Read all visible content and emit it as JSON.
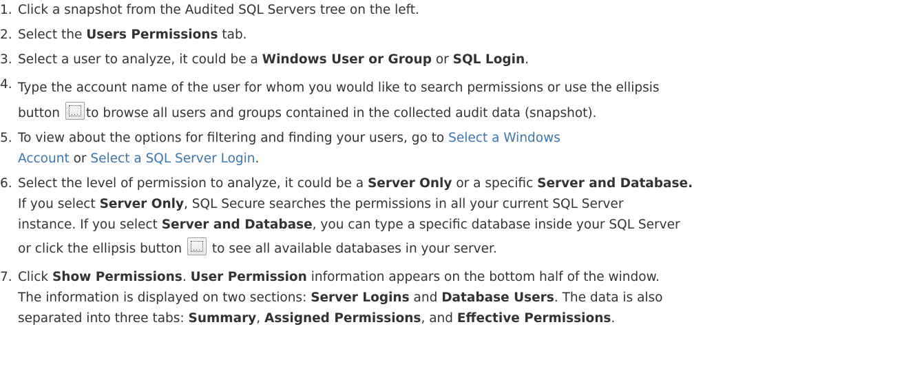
{
  "steps": [
    {
      "num": "1.",
      "t1": "Click a snapshot from the Audited SQL Servers tree on the left."
    },
    {
      "num": "2.",
      "t1": "Select the ",
      "b1": "Users Permissions",
      "t2": " tab."
    },
    {
      "num": "3.",
      "t1": "Select a user to analyze, it could be a ",
      "b1": "Windows User or Group",
      "t2": " or ",
      "b2": "SQL Login",
      "t3": "."
    },
    {
      "num": "4.",
      "line1": "Type the account name of the user for whom you would like to search permissions or use the ellipsis",
      "line2_pre": "button ",
      "line2_post": "to browse all users and groups contained in the collected audit data (snapshot)."
    },
    {
      "num": "5.",
      "t1": "To view about the options for filtering and finding your users, go to ",
      "link1_a": "Select a Windows",
      "link1_b": "Account",
      "t2": " or ",
      "link2": "Select a SQL Server Login",
      "t3": "."
    },
    {
      "num": "6.",
      "t1": "Select the level of permission to analyze, it could be a ",
      "b1": "Server Only",
      "t2": " or a specific ",
      "b2": "Server and Database.",
      "t3": "If you select ",
      "b3": "Server Only",
      "t4": ", SQL Secure searches the permissions in all your current SQL Server",
      "t5": "instance. If you select ",
      "b4": "Server and Database",
      "t6": ", you can type a specific database inside your SQL Server",
      "t7": "or click the ellipsis button ",
      "t8": " to see all available databases in your server."
    },
    {
      "num": "7.",
      "t1": "Click ",
      "b1": "Show Permissions",
      "t2": ". ",
      "b2": "User Permission",
      "t3": " information appears on the bottom half of the window.",
      "t4": "The information is displayed on two sections: ",
      "b3": "Server Logins",
      "t5": " and ",
      "b4": "Database Users",
      "t6": ". The data is also",
      "t7": "separated into three tabs: ",
      "b5": "Summary",
      "t8": ", ",
      "b6": "Assigned Permissions",
      "t9": ", and ",
      "b7": "Effective Permissions",
      "t10": "."
    }
  ],
  "ellipsis_button": {
    "label": "..."
  },
  "colors": {
    "text": "#333333",
    "link": "#3a76b0"
  }
}
